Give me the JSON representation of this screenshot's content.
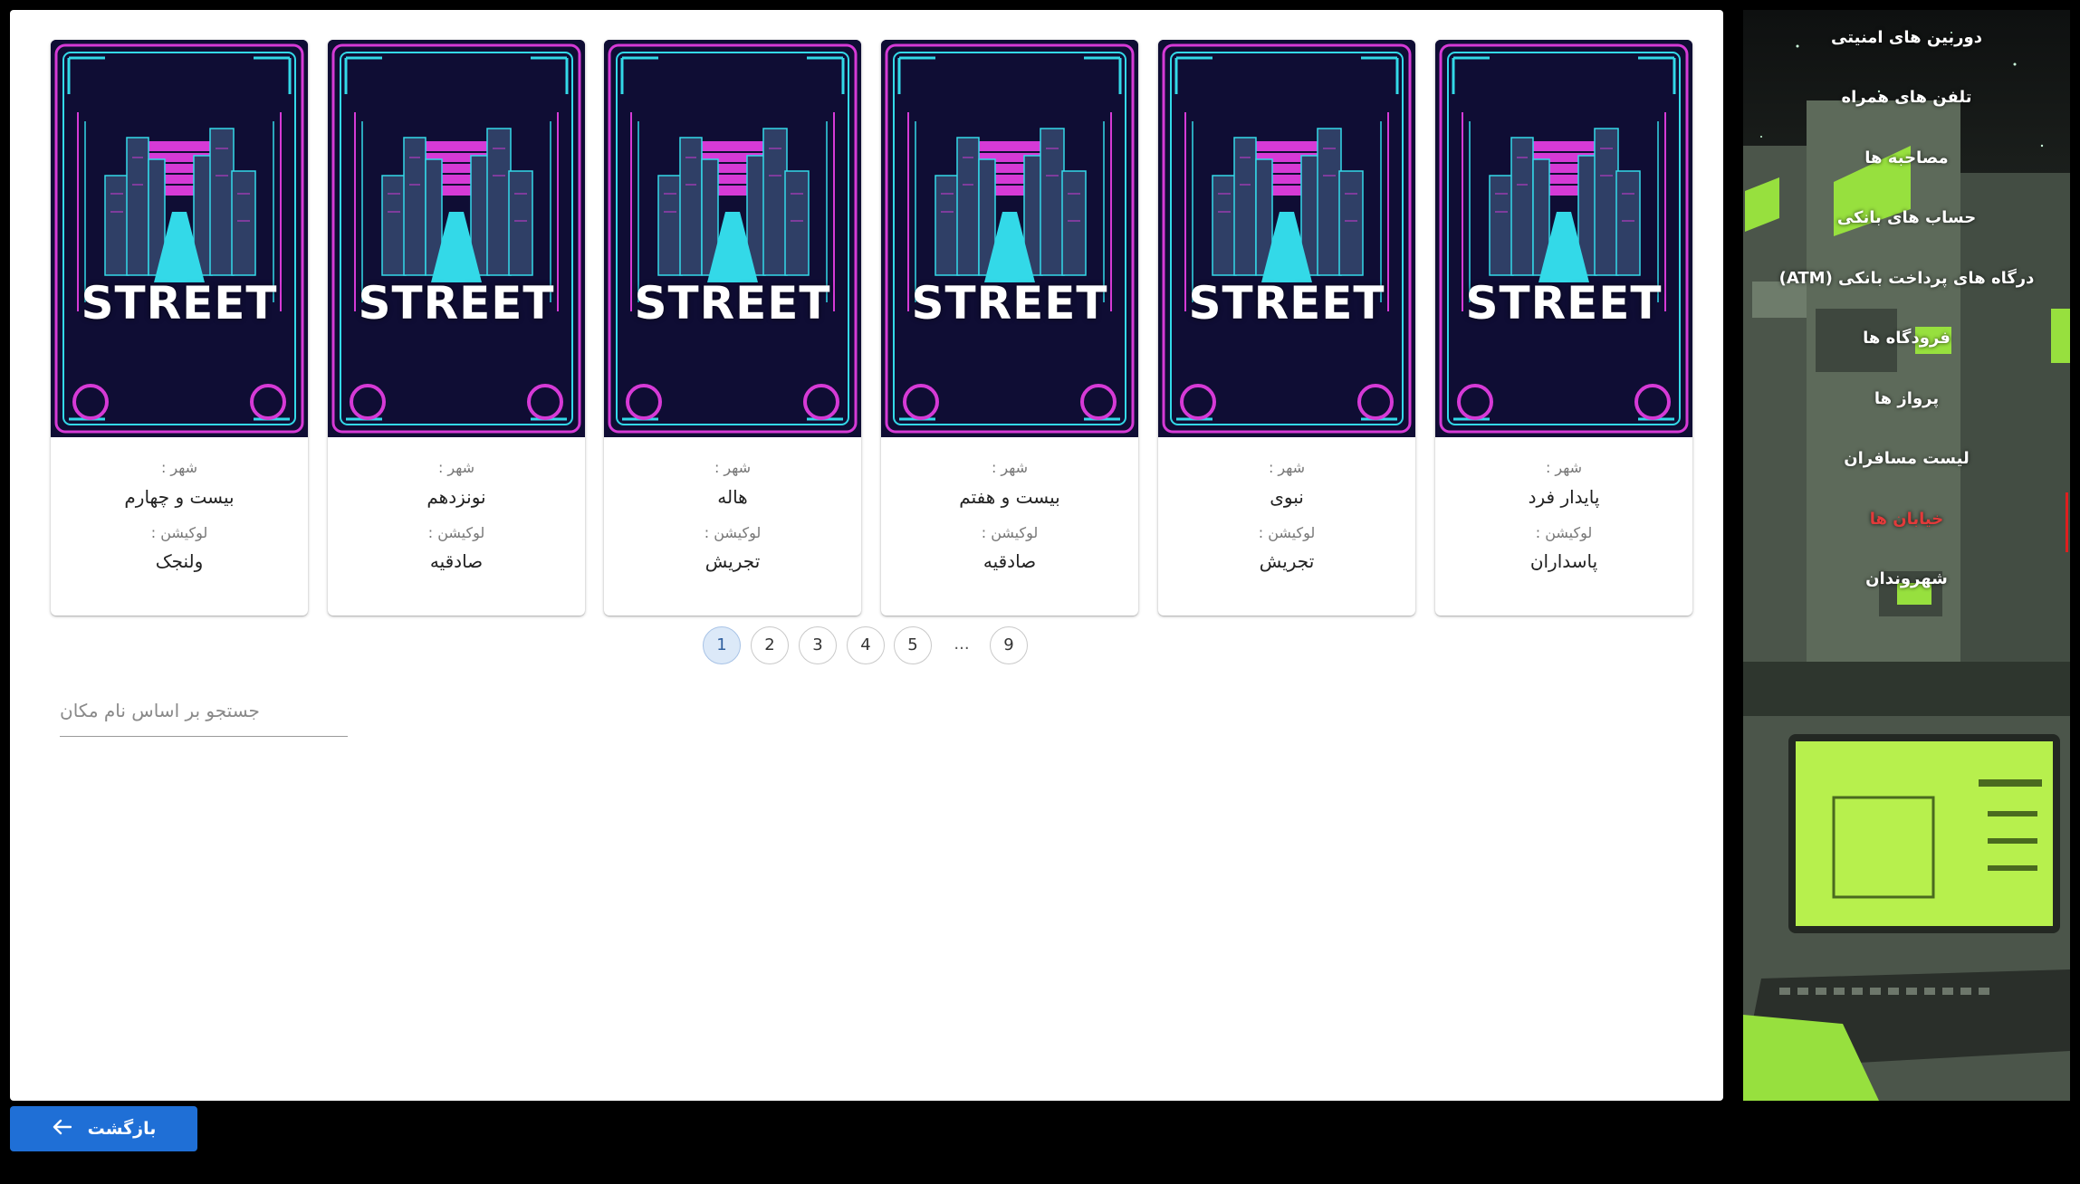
{
  "cards": [
    {
      "image_text": "STREET",
      "city_label": "شهر :",
      "city": "پایدار فرد",
      "location_label": "لوکیشن :",
      "location": "پاسداران"
    },
    {
      "image_text": "STREET",
      "city_label": "شهر :",
      "city": "نبوی",
      "location_label": "لوکیشن :",
      "location": "تجریش"
    },
    {
      "image_text": "STREET",
      "city_label": "شهر :",
      "city": "بیست و هفتم",
      "location_label": "لوکیشن :",
      "location": "صادقیه"
    },
    {
      "image_text": "STREET",
      "city_label": "شهر :",
      "city": "هاله",
      "location_label": "لوکیشن :",
      "location": "تجریش"
    },
    {
      "image_text": "STREET",
      "city_label": "شهر :",
      "city": "نونزدهم",
      "location_label": "لوکیشن :",
      "location": "صادقیه"
    },
    {
      "image_text": "STREET",
      "city_label": "شهر :",
      "city": "بیست و چهارم",
      "location_label": "لوکیشن :",
      "location": "ولنجک"
    }
  ],
  "pagination": {
    "pages": [
      "1",
      "2",
      "3",
      "4",
      "5"
    ],
    "ellipsis": "...",
    "last": "9",
    "current": 1
  },
  "search": {
    "placeholder": "جستجو بر اساس نام مکان",
    "value": ""
  },
  "back_button": {
    "label": "بازگشت",
    "icon": "arrow-left-icon"
  },
  "sidebar": {
    "items": [
      {
        "label": "دوربین های امنیتی"
      },
      {
        "label": "تلفن های همراه"
      },
      {
        "label": "مصاحبه ها"
      },
      {
        "label": "حساب های بانکی"
      },
      {
        "label": "درگاه های پرداخت بانکی (ATM)"
      },
      {
        "label": "فرودگاه ها"
      },
      {
        "label": "پرواز ها"
      },
      {
        "label": "لیست مسافران"
      },
      {
        "label": "خیابان ها"
      },
      {
        "label": "شهروندان"
      }
    ],
    "active_index": 8
  },
  "colors": {
    "accent": "#1f6fd6",
    "active_nav": "#e23a3a",
    "card_bg": "#0f0d34",
    "neon_pink": "#d63ad6",
    "neon_cyan": "#33d9e8"
  }
}
